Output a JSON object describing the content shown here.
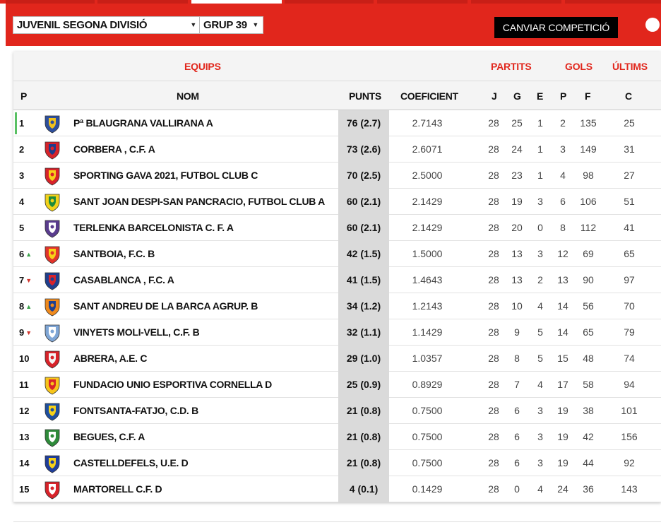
{
  "controls": {
    "competition": "JUVENIL SEGONA DIVISIÓ",
    "group": "GRUP 39",
    "change_button": "CANVIAR COMPETICIÓ"
  },
  "groups": {
    "teams": "EQUIPS",
    "matches": "PARTITS",
    "goals": "GOLS",
    "last": "ÚLTIMS"
  },
  "columns": {
    "pos": "P",
    "name": "NOM",
    "points": "PUNTS",
    "coef": "COEFICIENT",
    "played": "J",
    "won": "G",
    "drawn": "E",
    "lost": "P",
    "gf": "F",
    "ga": "C"
  },
  "colors": {
    "accent": "#e1261c",
    "up": "#3aa14a",
    "down": "#d0342c"
  },
  "rows": [
    {
      "pos": "1",
      "trend": "",
      "name": "Pª BLAUGRANA VALLIRANA A",
      "points": "76 (2.7)",
      "coef": "2.7143",
      "j": "28",
      "g": "25",
      "e": "1",
      "p": "2",
      "f": "135",
      "c": "25",
      "crest": "blue-shield-crest-icon"
    },
    {
      "pos": "2",
      "trend": "",
      "name": "CORBERA , C.F. A",
      "points": "73 (2.6)",
      "coef": "2.6071",
      "j": "28",
      "g": "24",
      "e": "1",
      "p": "3",
      "f": "149",
      "c": "31",
      "crest": "red-round-crest-icon"
    },
    {
      "pos": "3",
      "trend": "",
      "name": "SPORTING GAVA 2021, FUTBOL CLUB C",
      "points": "70 (2.5)",
      "coef": "2.5000",
      "j": "28",
      "g": "23",
      "e": "1",
      "p": "4",
      "f": "98",
      "c": "27",
      "crest": "red-yellow-round-crest-icon"
    },
    {
      "pos": "4",
      "trend": "",
      "name": "SANT JOAN DESPI-SAN PANCRACIO, FUTBOL CLUB A",
      "points": "60 (2.1)",
      "coef": "2.1429",
      "j": "28",
      "g": "19",
      "e": "3",
      "p": "6",
      "f": "106",
      "c": "51",
      "crest": "green-yellow-shield-crest-icon"
    },
    {
      "pos": "5",
      "trend": "",
      "name": "TERLENKA BARCELONISTA C. F. A",
      "points": "60 (2.1)",
      "coef": "2.1429",
      "j": "28",
      "g": "20",
      "e": "0",
      "p": "8",
      "f": "112",
      "c": "41",
      "crest": "purple-oval-crest-icon"
    },
    {
      "pos": "6",
      "trend": "up",
      "name": "SANTBOIA, F.C. B",
      "points": "42 (1.5)",
      "coef": "1.5000",
      "j": "28",
      "g": "13",
      "e": "3",
      "p": "12",
      "f": "69",
      "c": "65",
      "crest": "striped-shield-crest-icon"
    },
    {
      "pos": "7",
      "trend": "down",
      "name": "CASABLANCA , F.C. A",
      "points": "41 (1.5)",
      "coef": "1.4643",
      "j": "28",
      "g": "13",
      "e": "2",
      "p": "13",
      "f": "90",
      "c": "97",
      "crest": "blue-red-shield-crest-icon"
    },
    {
      "pos": "8",
      "trend": "up",
      "name": "SANT ANDREU DE LA BARCA AGRUP. B",
      "points": "34 (1.2)",
      "coef": "1.2143",
      "j": "28",
      "g": "10",
      "e": "4",
      "p": "14",
      "f": "56",
      "c": "70",
      "crest": "orange-shield-crest-icon"
    },
    {
      "pos": "9",
      "trend": "down",
      "name": "VINYETS MOLI-VELL, C.F. B",
      "points": "32 (1.1)",
      "coef": "1.1429",
      "j": "28",
      "g": "9",
      "e": "5",
      "p": "14",
      "f": "65",
      "c": "79",
      "crest": "light-blue-crest-icon"
    },
    {
      "pos": "10",
      "trend": "",
      "name": "ABRERA, A.E. C",
      "points": "29 (1.0)",
      "coef": "1.0357",
      "j": "28",
      "g": "8",
      "e": "5",
      "p": "15",
      "f": "48",
      "c": "74",
      "crest": "red-white-shield-crest-icon"
    },
    {
      "pos": "11",
      "trend": "",
      "name": "FUNDACIO UNIO ESPORTIVA CORNELLA D",
      "points": "25 (0.9)",
      "coef": "0.8929",
      "j": "28",
      "g": "7",
      "e": "4",
      "p": "17",
      "f": "58",
      "c": "94",
      "crest": "yellow-red-crest-icon"
    },
    {
      "pos": "12",
      "trend": "",
      "name": "FONTSANTA-FATJO, C.D. B",
      "points": "21 (0.8)",
      "coef": "0.7500",
      "j": "28",
      "g": "6",
      "e": "3",
      "p": "19",
      "f": "38",
      "c": "101",
      "crest": "blue-yellow-shield-crest-icon"
    },
    {
      "pos": "13",
      "trend": "",
      "name": "BEGUES, C.F. A",
      "points": "21 (0.8)",
      "coef": "0.7500",
      "j": "28",
      "g": "6",
      "e": "3",
      "p": "19",
      "f": "42",
      "c": "156",
      "crest": "green-round-crest-icon"
    },
    {
      "pos": "14",
      "trend": "",
      "name": "CASTELLDEFELS, U.E. D",
      "points": "21 (0.8)",
      "coef": "0.7500",
      "j": "28",
      "g": "6",
      "e": "3",
      "p": "19",
      "f": "44",
      "c": "92",
      "crest": "blue-yellow-crest-icon"
    },
    {
      "pos": "15",
      "trend": "",
      "name": "MARTORELL C.F. D",
      "points": "4 (0.1)",
      "coef": "0.1429",
      "j": "28",
      "g": "0",
      "e": "4",
      "p": "24",
      "f": "36",
      "c": "143",
      "crest": "red-stripes-shield-crest-icon"
    }
  ]
}
